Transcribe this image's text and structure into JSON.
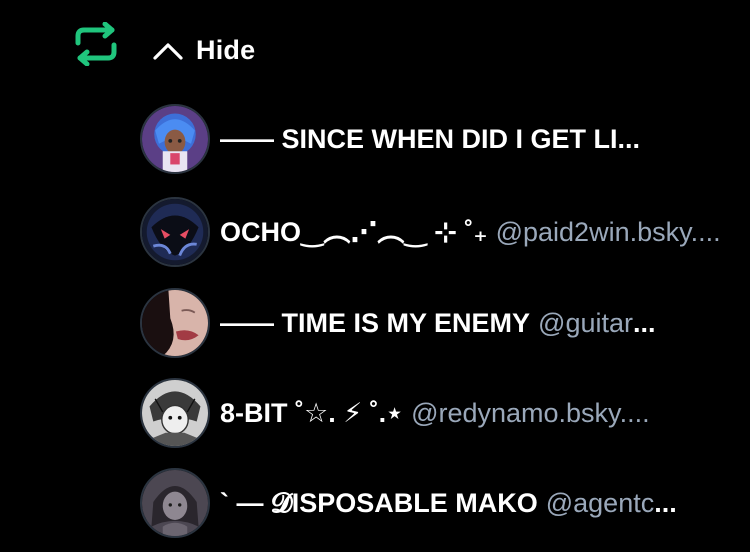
{
  "header": {
    "hide_label": "Hide"
  },
  "colors": {
    "repost_accent": "#20c57d",
    "handle_gray": "#9aa8ba",
    "background": "#000000"
  },
  "users": [
    {
      "name": "—— SINCE WHEN DID I GET LI",
      "handle": "",
      "ellipsis": "...",
      "avatar": "blue-haired-character-avatar"
    },
    {
      "name": "OCHO‿︵⋰︵‿ ⊹ ˚₊",
      "handle": "@paid2win.bsky",
      "ellipsis": "....",
      "avatar": "dark-masked-character-avatar"
    },
    {
      "name": "—— TIME IS MY ENEMY",
      "handle": "@guitar",
      "ellipsis": "...",
      "avatar": "face-closeup-avatar"
    },
    {
      "name": "8-BIT ˚☆. ⚡ ˚.⋆",
      "handle": "@redynamo.bsky",
      "ellipsis": "....",
      "avatar": "sketch-character-avatar"
    },
    {
      "name": "` — 𝓓ISPOSABLE MAKO",
      "handle": "@agentc",
      "ellipsis": "...",
      "avatar": "gray-character-avatar"
    }
  ]
}
